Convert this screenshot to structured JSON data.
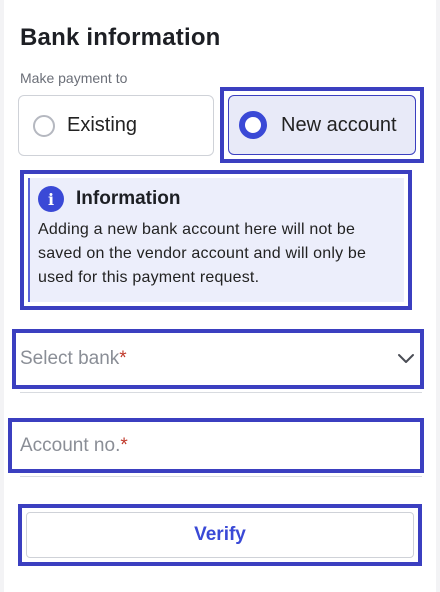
{
  "section": {
    "title": "Bank information",
    "subtitle": "Make payment to"
  },
  "payment_options": [
    {
      "label": "Existing",
      "selected": false
    },
    {
      "label": "New account",
      "selected": true
    }
  ],
  "info_box": {
    "title": "Information",
    "icon": "info-icon",
    "body": "Adding a new bank account here will not be saved on the vendor account and will only be used for this payment request."
  },
  "bank_select": {
    "placeholder": "Select bank",
    "required_marker": "*",
    "icon": "chevron-down-icon"
  },
  "account_input": {
    "placeholder": "Account no.",
    "required_marker": "*"
  },
  "verify_button": {
    "label": "Verify"
  },
  "colors": {
    "accent": "#3a49d6",
    "highlight_border": "#3b3fc0",
    "info_background": "#eceefb",
    "required": "#c0392b"
  }
}
